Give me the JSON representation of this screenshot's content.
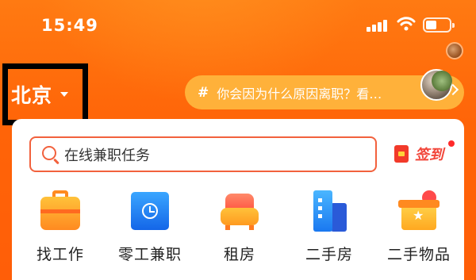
{
  "status_bar": {
    "time": "15:49"
  },
  "location": {
    "city": "北京"
  },
  "topic": {
    "hash": "#",
    "text": "你会因为什么原因离职？看…"
  },
  "search": {
    "placeholder": "在线兼职任务"
  },
  "signin": {
    "label": "签到"
  },
  "categories": [
    {
      "label": "找工作",
      "icon": "briefcase-icon"
    },
    {
      "label": "零工兼职",
      "icon": "clock-icon"
    },
    {
      "label": "租房",
      "icon": "sofa-icon"
    },
    {
      "label": "二手房",
      "icon": "building-icon"
    },
    {
      "label": "二手物品",
      "icon": "box-icon"
    }
  ],
  "colors": {
    "header_orange": "#ff6a10",
    "search_border": "#f2613d",
    "topic_pill": "#ffb13a",
    "signin_red": "#f2463a"
  }
}
